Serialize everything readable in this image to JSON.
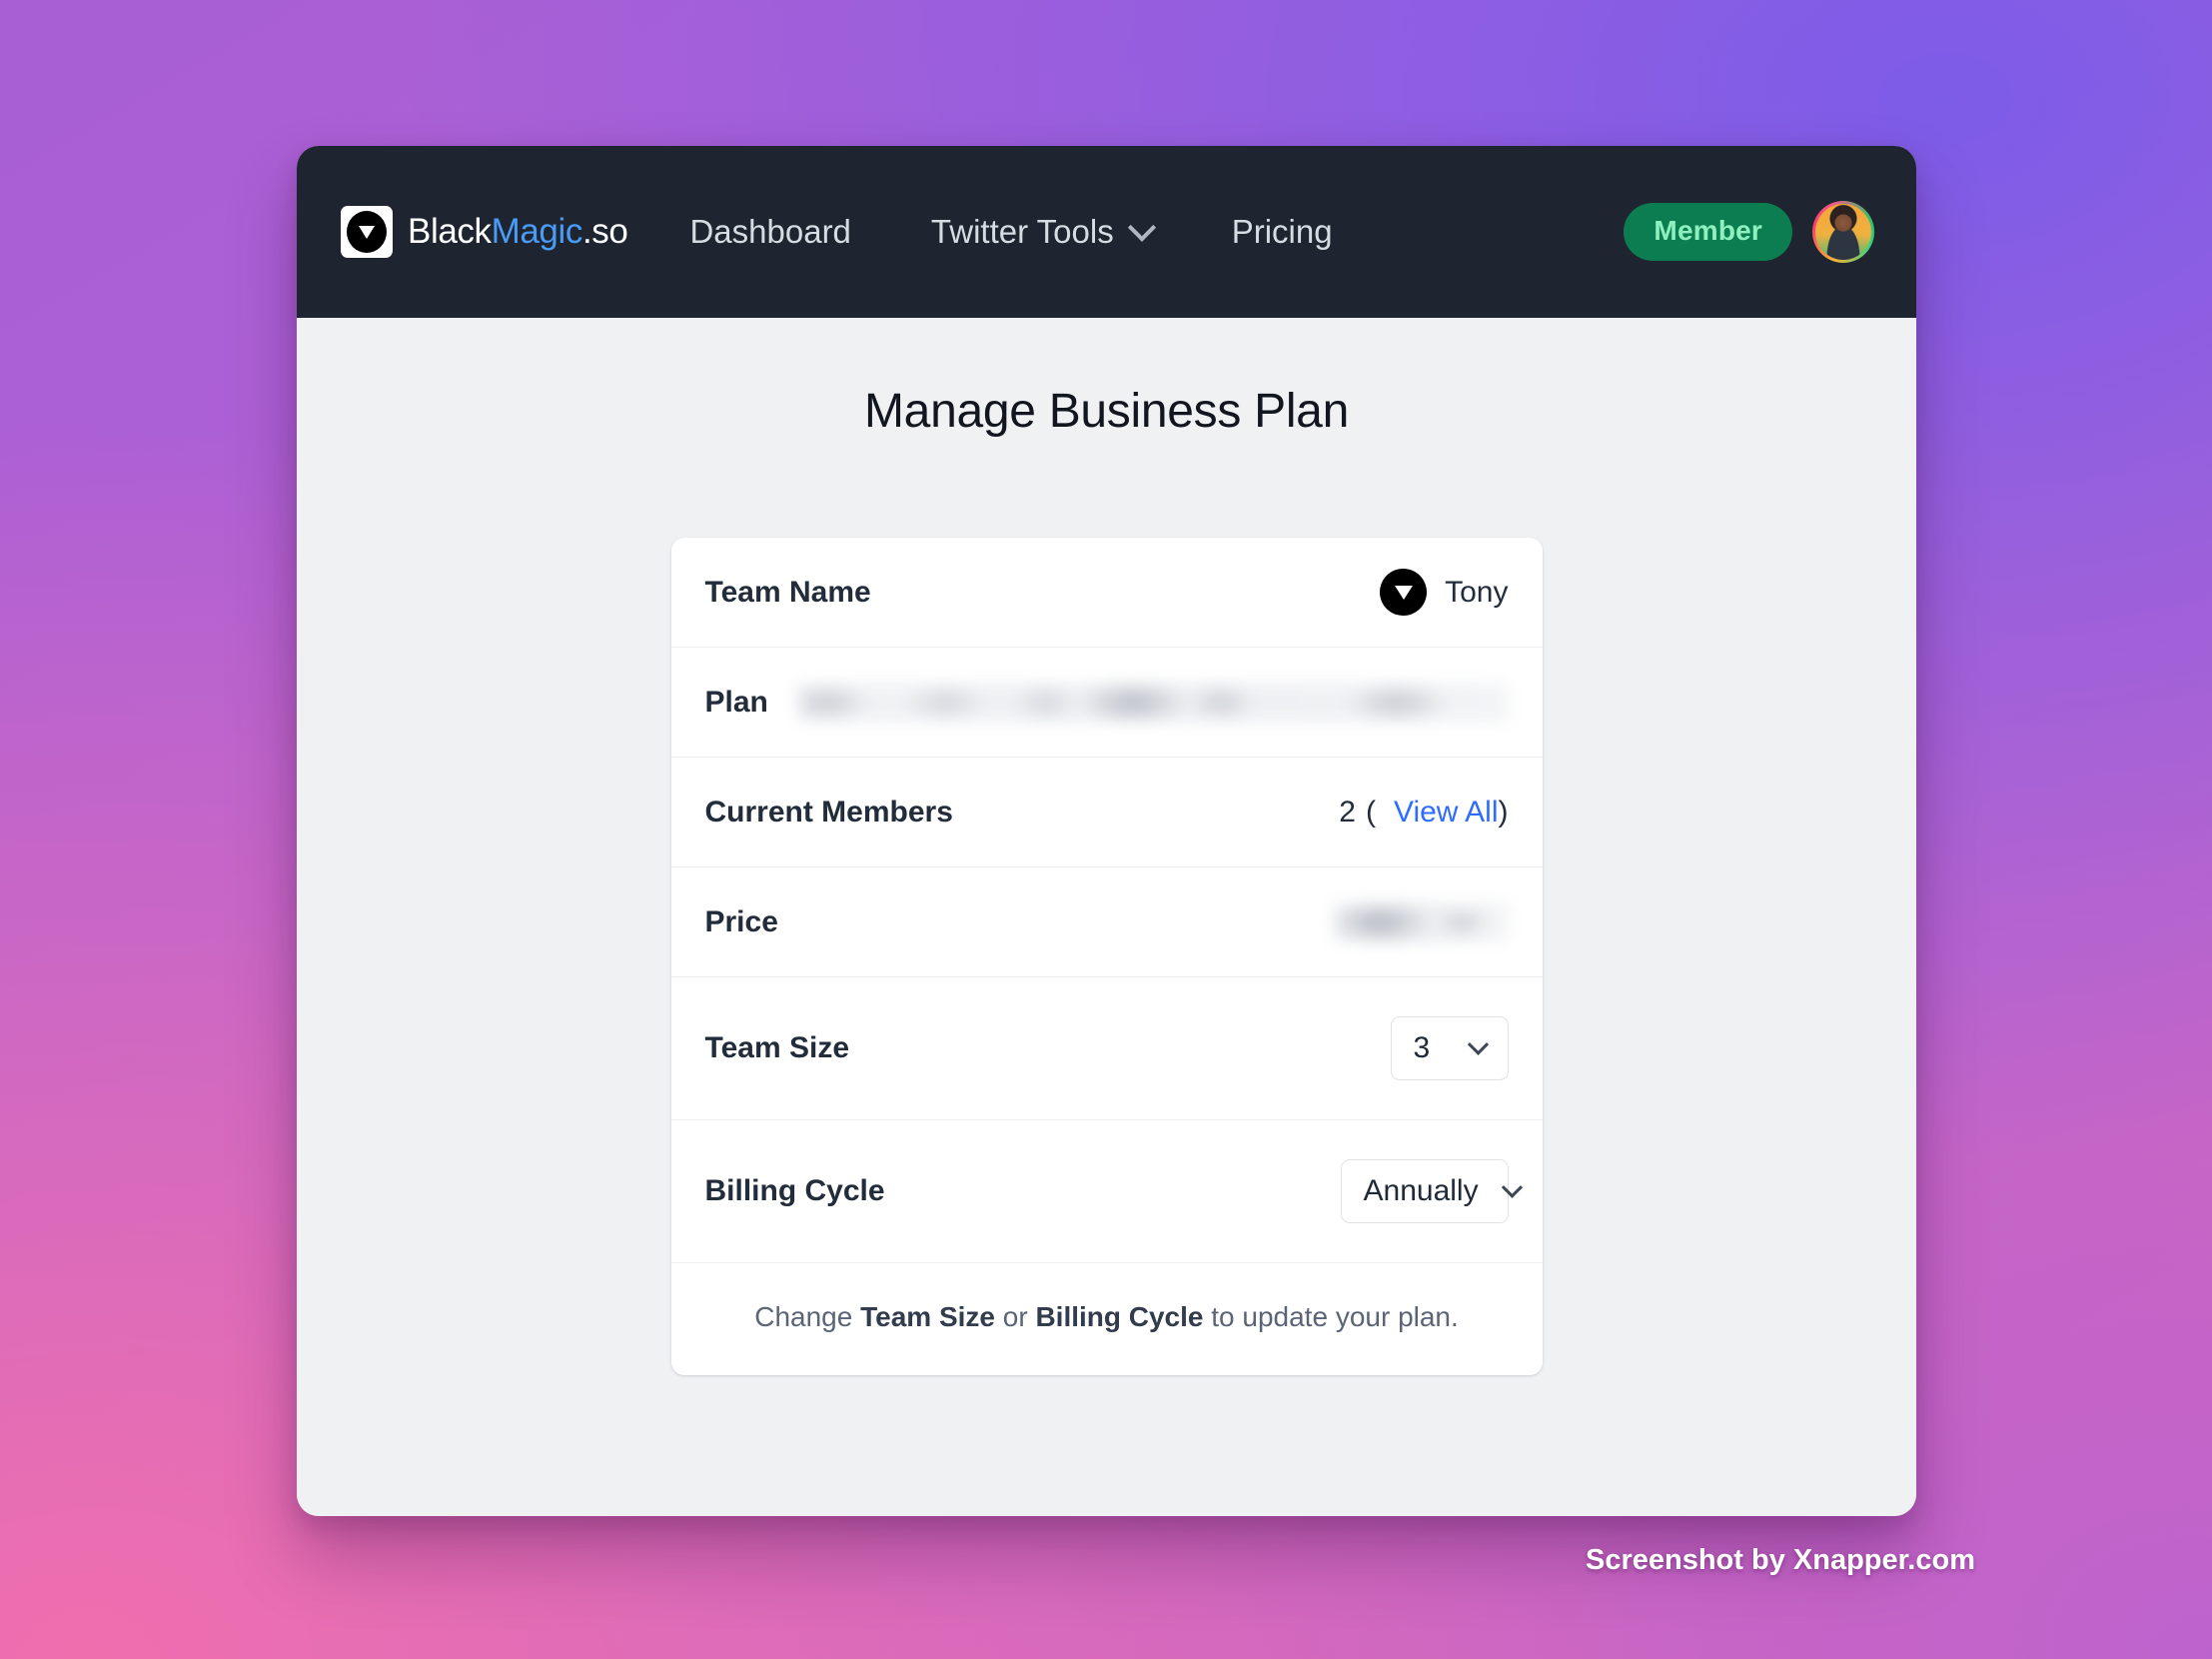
{
  "navbar": {
    "brand": {
      "part1": "Black",
      "part2": "Magic",
      "part3": ".so"
    },
    "links": [
      {
        "label": "Dashboard",
        "has_chevron": false
      },
      {
        "label": "Twitter Tools",
        "has_chevron": true
      },
      {
        "label": "Pricing",
        "has_chevron": false
      }
    ],
    "member_badge": "Member",
    "icons": {
      "chevron": "chevron-down-icon",
      "avatar": "user-avatar"
    },
    "colors": {
      "bar_bg": "#1e2530",
      "brand_accent": "#4a9bf5",
      "badge_bg": "#0b7d50",
      "badge_text": "#8ff0bf"
    }
  },
  "page": {
    "title": "Manage Business Plan"
  },
  "card": {
    "rows": {
      "team_name": {
        "label": "Team Name",
        "value": "Tony"
      },
      "plan": {
        "label": "Plan",
        "value": "",
        "redacted": true
      },
      "current_members": {
        "label": "Current Members",
        "count": "2",
        "open_paren": "(",
        "link": "View All",
        "close_paren": ")"
      },
      "price": {
        "label": "Price",
        "value": "",
        "redacted": true
      },
      "team_size": {
        "label": "Team Size",
        "value": "3"
      },
      "billing_cycle": {
        "label": "Billing Cycle",
        "value": "Annually"
      }
    },
    "footer": {
      "part1": "Change ",
      "bold1": "Team Size",
      "part2": " or ",
      "bold2": "Billing Cycle",
      "part3": " to update your plan."
    }
  },
  "watermark": "Screenshot by Xnapper.com"
}
